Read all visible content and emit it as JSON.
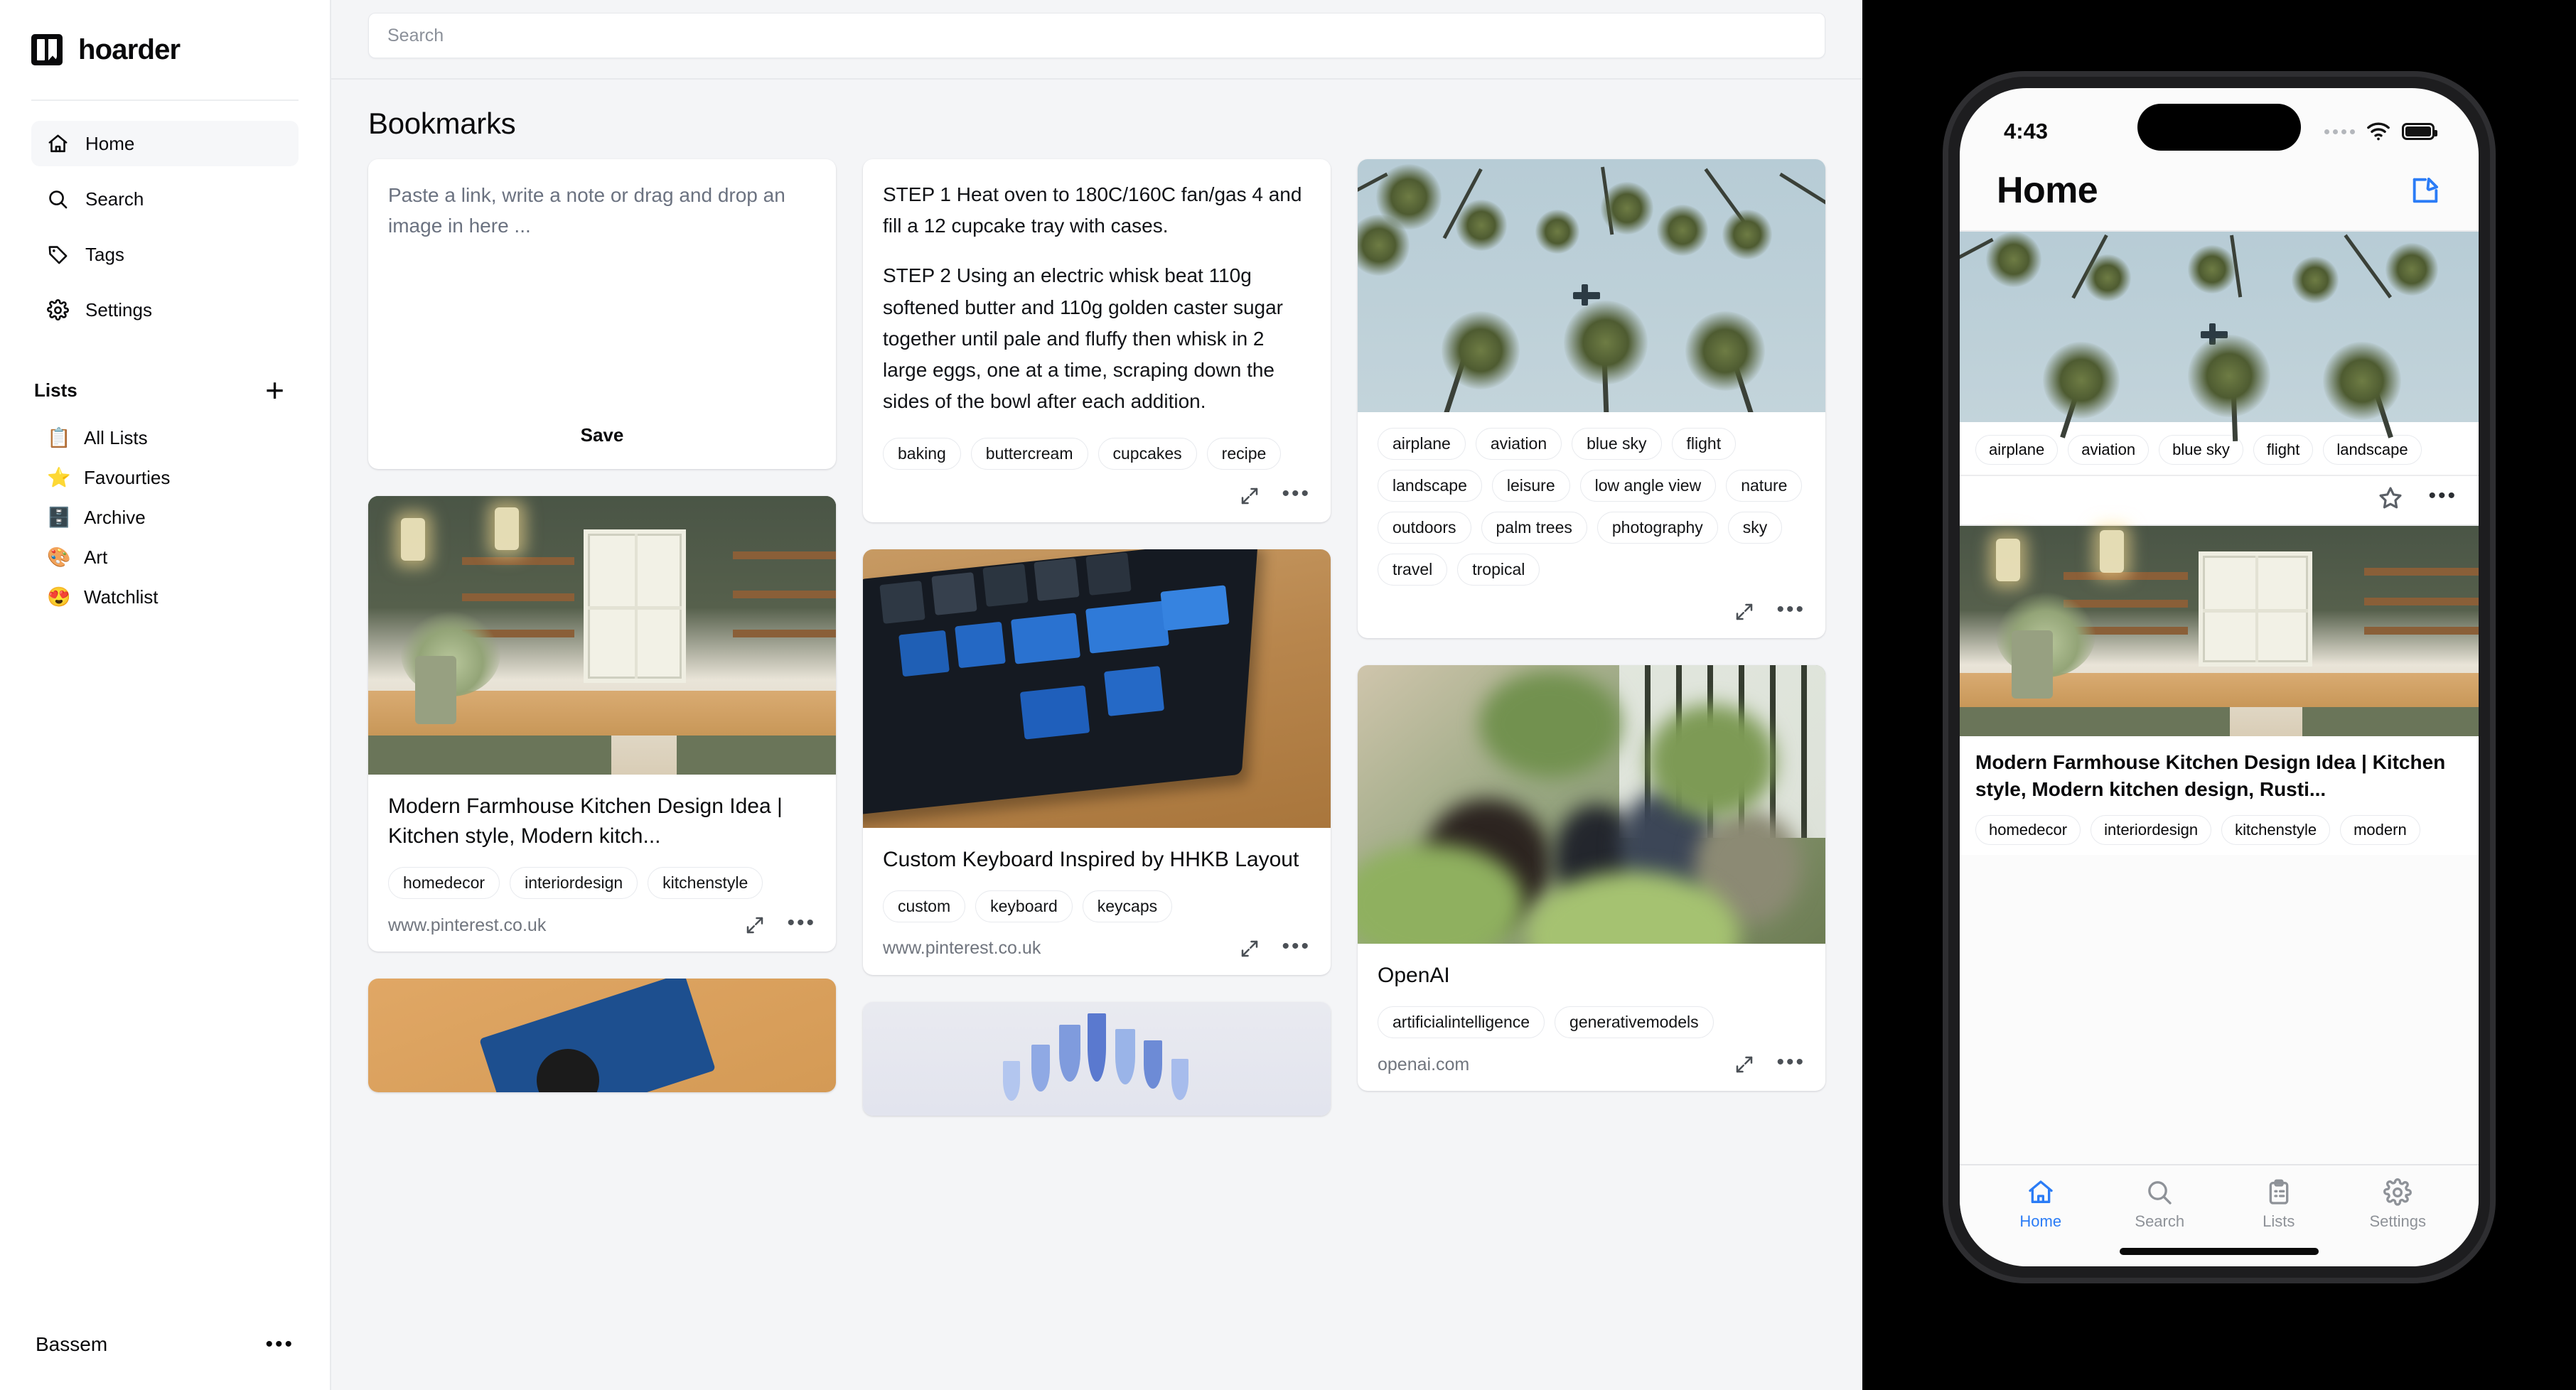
{
  "sidebar": {
    "brand": "hoarder",
    "nav": [
      {
        "label": "Home",
        "icon": "home-icon",
        "active": true
      },
      {
        "label": "Search",
        "icon": "search-icon",
        "active": false
      },
      {
        "label": "Tags",
        "icon": "tag-icon",
        "active": false
      },
      {
        "label": "Settings",
        "icon": "gear-icon",
        "active": false
      }
    ],
    "lists_title": "Lists",
    "add_list_label": "+",
    "lists": [
      {
        "emoji": "📋",
        "label": "All Lists"
      },
      {
        "emoji": "⭐",
        "label": "Favourties"
      },
      {
        "emoji": "🗄️",
        "label": "Archive"
      },
      {
        "emoji": "🎨",
        "label": "Art"
      },
      {
        "emoji": "😍",
        "label": "Watchlist"
      }
    ],
    "user": {
      "name": "Bassem",
      "menu_label": "•••"
    }
  },
  "search": {
    "placeholder": "Search",
    "value": ""
  },
  "main": {
    "page_title": "Bookmarks",
    "editor": {
      "placeholder": "Paste a link, write a note or drag and drop an image in here ...",
      "save_label": "Save"
    },
    "cards": [
      {
        "id": "note-cupcakes",
        "type": "note",
        "paragraphs": [
          "STEP 1 Heat oven to 180C/160C fan/gas 4 and fill a 12 cupcake tray with cases.",
          "STEP 2 Using an electric whisk beat 110g softened butter and 110g golden caster sugar together until pale and fluffy then whisk in 2 large eggs, one at a time, scraping down the sides of the bowl after each addition."
        ],
        "tags": [
          "baking",
          "buttercream",
          "cupcakes",
          "recipe"
        ],
        "url": ""
      },
      {
        "id": "image-palms",
        "type": "image",
        "title": "",
        "tags": [
          "airplane",
          "aviation",
          "blue sky",
          "flight",
          "landscape",
          "leisure",
          "low angle view",
          "nature",
          "outdoors",
          "palm trees",
          "photography",
          "sky",
          "travel",
          "tropical"
        ],
        "url": ""
      },
      {
        "id": "link-kitchen",
        "type": "link",
        "title": "Modern Farmhouse Kitchen Design Idea | Kitchen style, Modern kitch...",
        "tags": [
          "homedecor",
          "interiordesign",
          "kitchenstyle"
        ],
        "url": "www.pinterest.co.uk"
      },
      {
        "id": "link-keyboard",
        "type": "link",
        "title": "Custom Keyboard Inspired by HHKB Layout",
        "tags": [
          "custom",
          "keyboard",
          "keycaps"
        ],
        "url": "www.pinterest.co.uk"
      },
      {
        "id": "link-openai",
        "type": "link",
        "title": "OpenAI",
        "tags": [
          "artificialintelligence",
          "generativemodels"
        ],
        "url": "openai.com"
      }
    ],
    "dots_label": "•••"
  },
  "phone": {
    "status": {
      "time": "4:43"
    },
    "header": {
      "title": "Home",
      "compose_icon": "compose-icon"
    },
    "cards": [
      {
        "id": "ph-palms",
        "image": "palms",
        "title": "",
        "tags": [
          "airplane",
          "aviation",
          "blue sky",
          "flight",
          "landscape"
        ]
      },
      {
        "id": "ph-kitchen",
        "image": "kitchen",
        "title": "Modern Farmhouse Kitchen Design Idea | Kitchen style, Modern kitchen design, Rusti...",
        "tags": [
          "homedecor",
          "interiordesign",
          "kitchenstyle",
          "modern"
        ]
      }
    ],
    "dots_label": "•••",
    "tabs": [
      {
        "label": "Home",
        "icon": "home-icon",
        "active": true
      },
      {
        "label": "Search",
        "icon": "search-icon",
        "active": false
      },
      {
        "label": "Lists",
        "icon": "clipboard-icon",
        "active": false
      },
      {
        "label": "Settings",
        "icon": "gear-icon",
        "active": false
      }
    ]
  },
  "colors": {
    "accent": "#2b7cf6",
    "bg": "#f4f5f7",
    "card": "#ffffff",
    "text": "#09090b"
  }
}
